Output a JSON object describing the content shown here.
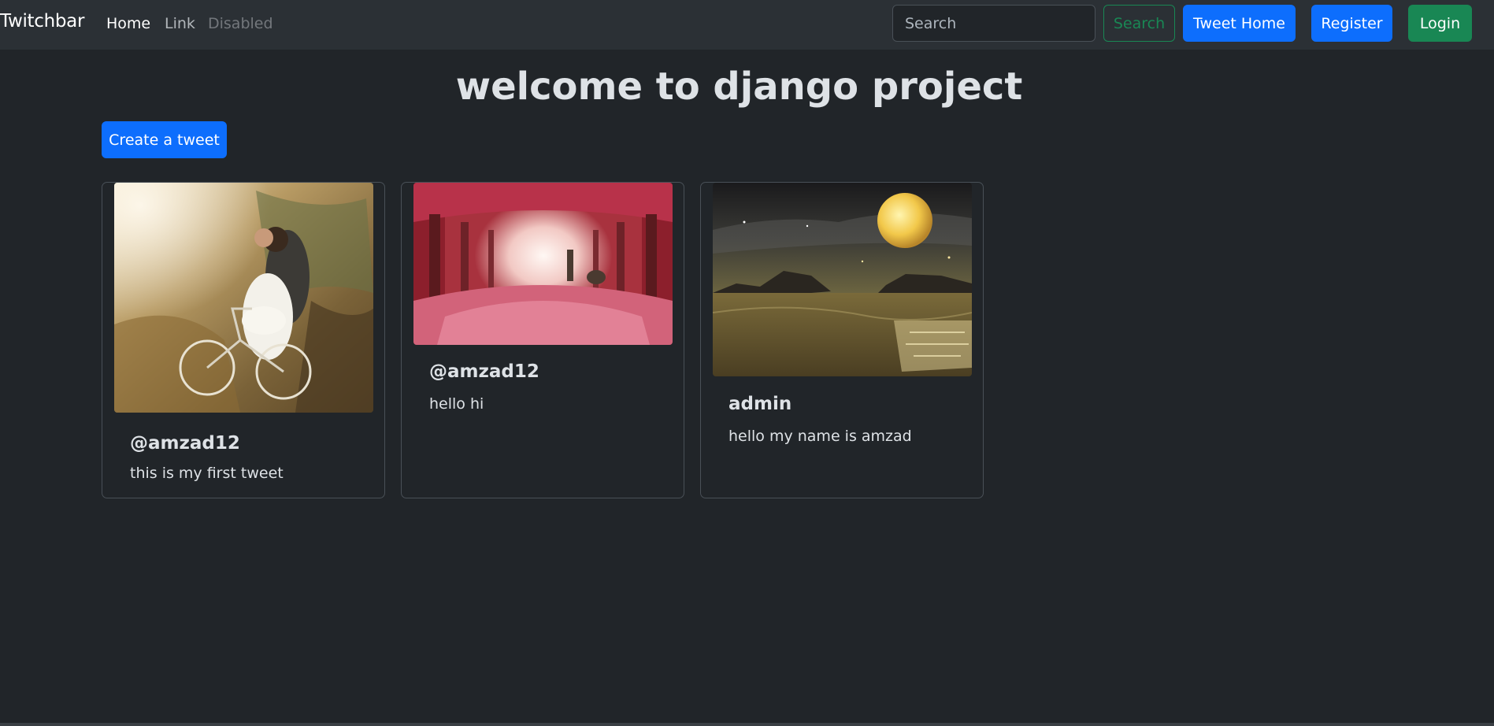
{
  "navbar": {
    "brand": "Twitchbar",
    "links": [
      {
        "label": "Home"
      },
      {
        "label": "Link"
      },
      {
        "label": "Disabled"
      }
    ],
    "search_placeholder": "Search",
    "search_button": "Search",
    "tweet_home_button": "Tweet Home",
    "register_button": "Register",
    "login_button": "Login"
  },
  "main": {
    "title": "welcome to django project",
    "create_button": "Create a tweet",
    "tweets": [
      {
        "user": "@amzad12",
        "text": "this is my first tweet",
        "image": "couple-on-bicycle-painting"
      },
      {
        "user": "@amzad12",
        "text": "hello hi",
        "image": "pink-blossom-tree-avenue"
      },
      {
        "user": "admin",
        "text": "hello my name is amzad",
        "image": "full-moon-over-lake"
      }
    ]
  },
  "colors": {
    "background": "#212529",
    "navbar": "#2b3035",
    "primary": "#0d6efd",
    "success": "#198754"
  }
}
